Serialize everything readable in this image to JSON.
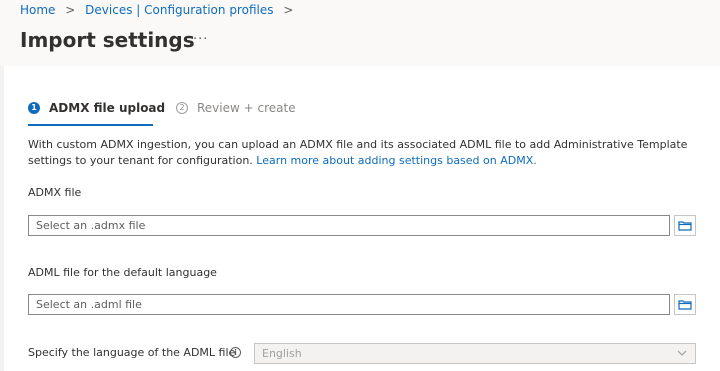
{
  "breadcrumb": {
    "items": [
      "Home",
      "Devices | Configuration profiles"
    ],
    "separator": ">"
  },
  "page": {
    "title": "Import settings",
    "more_label": "..."
  },
  "steps": [
    {
      "number": "1",
      "label": "ADMX file upload",
      "active": true
    },
    {
      "number": "2",
      "label": "Review + create",
      "active": false
    }
  ],
  "description": {
    "text": "With custom ADMX ingestion, you can upload an ADMX file and its associated ADML file to add Administrative Template settings to your tenant for configuration.",
    "link": "Learn more about adding settings based on ADMX."
  },
  "admx": {
    "label": "ADMX file",
    "placeholder": "Select an .admx file"
  },
  "adml": {
    "label": "ADML file for the default language",
    "placeholder": "Select an .adml file"
  },
  "language": {
    "label": "Specify the language of the ADML file",
    "value": "English"
  },
  "colors": {
    "accent": "#0f6cbd",
    "text": "#323130",
    "disabled_text": "#a19f9d"
  },
  "icons": {
    "browse": "folder-icon",
    "info": "info-icon",
    "dropdown": "chevron-down-icon"
  }
}
